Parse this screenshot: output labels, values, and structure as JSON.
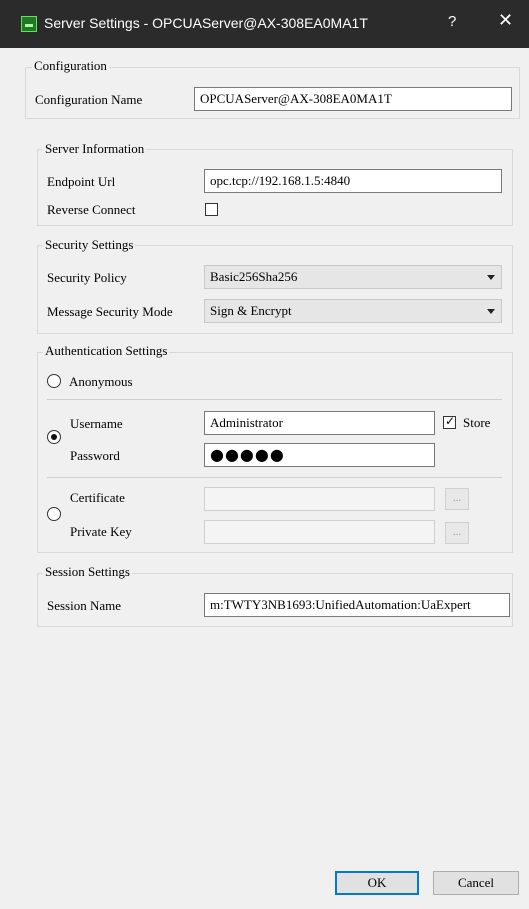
{
  "window": {
    "title": "Server Settings - OPCUAServer@AX-308EA0MA1T",
    "help": "?",
    "close": "✕"
  },
  "configuration": {
    "group_title": "Configuration",
    "name_label": "Configuration Name",
    "name_value": "OPCUAServer@AX-308EA0MA1T"
  },
  "server_information": {
    "group_title": "Server Information",
    "endpoint_label": "Endpoint Url",
    "endpoint_value": "opc.tcp://192.168.1.5:4840",
    "reverse_label": "Reverse Connect",
    "reverse_checked": false
  },
  "security_settings": {
    "group_title": "Security Settings",
    "policy_label": "Security Policy",
    "policy_value": "Basic256Sha256",
    "mode_label": "Message Security Mode",
    "mode_value": "Sign & Encrypt"
  },
  "authentication": {
    "group_title": "Authentication Settings",
    "anonymous_label": "Anonymous",
    "username_label": "Username",
    "username_value": "Administrator",
    "store_label": "Store",
    "store_checked": true,
    "password_label": "Password",
    "password_mask": "●●●●●",
    "certificate_label": "Certificate",
    "private_key_label": "Private Key",
    "browse_label": "...",
    "selected": "username"
  },
  "session_settings": {
    "group_title": "Session Settings",
    "name_label": "Session Name",
    "name_value": "m:TWTY3NB1693:UnifiedAutomation:UaExpert"
  },
  "buttons": {
    "ok": "OK",
    "cancel": "Cancel"
  }
}
